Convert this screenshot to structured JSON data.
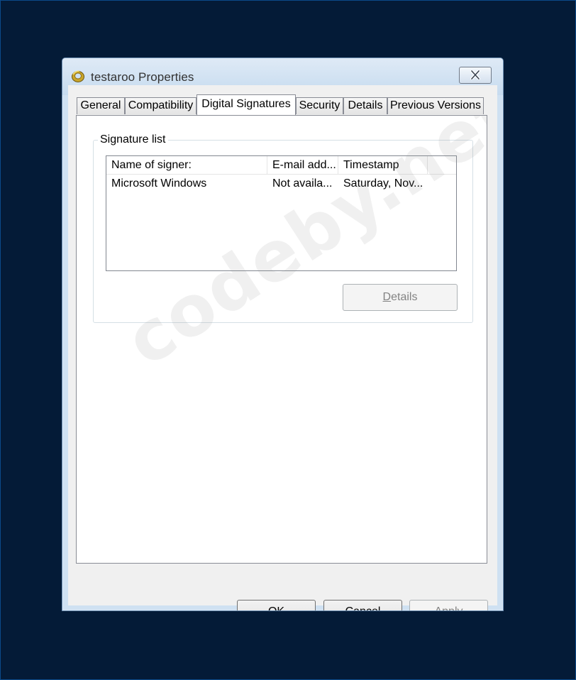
{
  "window": {
    "title": "testaroo Properties"
  },
  "tabs": [
    {
      "label": "General"
    },
    {
      "label": "Compatibility"
    },
    {
      "label": "Digital Signatures"
    },
    {
      "label": "Security"
    },
    {
      "label": "Details"
    },
    {
      "label": "Previous Versions"
    }
  ],
  "active_tab": "Digital Signatures",
  "signature_list": {
    "group_label": "Signature list",
    "columns": [
      "Name of signer:",
      "E-mail add...",
      "Timestamp"
    ],
    "rows": [
      [
        "Microsoft Windows",
        "Not availa...",
        "Saturday, Nov..."
      ]
    ],
    "details_button": {
      "label_prefix": "",
      "accel": "D",
      "label_rest": "etails"
    }
  },
  "watermark": "codeby.net",
  "buttons": {
    "ok": "OK",
    "cancel": "Cancel",
    "apply_accel": "A",
    "apply_rest": "pply"
  },
  "colors": {
    "desktop": "#041b37",
    "window_frame": "#cfe1f2",
    "dialog_bg": "#f0f0f0",
    "disabled_text": "#838383"
  },
  "icons": {
    "app": "gold-ring-icon",
    "close": "close-icon"
  }
}
